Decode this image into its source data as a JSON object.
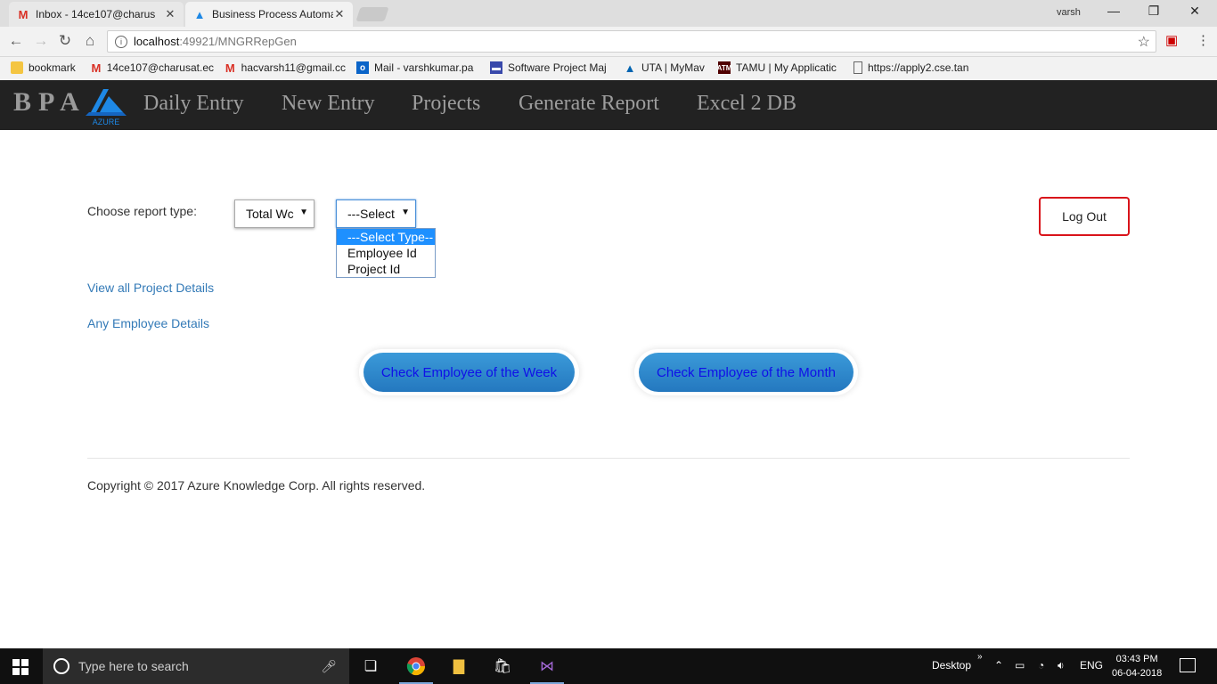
{
  "browser": {
    "tabs": [
      {
        "label": "Inbox - 14ce107@charus",
        "favicon": "gmail-icon",
        "active": false
      },
      {
        "label": "Business Process Automa",
        "favicon": "azure-icon",
        "active": true
      }
    ],
    "window_user": "varsh",
    "url_host": "localhost",
    "url_path": ":49921/MNGRRepGen",
    "bookmarks": [
      {
        "label": "bookmark",
        "icon": "folder-icon"
      },
      {
        "label": "14ce107@charusat.ec",
        "icon": "gmail-icon"
      },
      {
        "label": "hacvarsh11@gmail.cc",
        "icon": "gmail-icon"
      },
      {
        "label": "Mail - varshkumar.pa",
        "icon": "outlook-icon"
      },
      {
        "label": "Software Project Maj",
        "icon": "project-icon"
      },
      {
        "label": "UTA | MyMav",
        "icon": "uta-icon"
      },
      {
        "label": "TAMU | My Applicatic",
        "icon": "tamu-icon"
      },
      {
        "label": "https://apply2.cse.tan",
        "icon": "page-icon"
      }
    ]
  },
  "navbar": {
    "brand": "BPA",
    "logo_text": "AZURE",
    "links": [
      "Daily Entry",
      "New Entry",
      "Projects",
      "Generate Report",
      "Excel 2 DB"
    ]
  },
  "report": {
    "choose_label": "Choose report type:",
    "report_type_value": "Total Wc",
    "filter_value": "---Select",
    "dropdown_options": [
      "---Select Type---",
      "Employee Id",
      "Project Id"
    ],
    "selected_option_index": 0
  },
  "logout_label": "Log Out",
  "links": {
    "view_projects": "View all Project Details",
    "employee_details": "Any Employee Details"
  },
  "buttons": {
    "week": "Check Employee of the Week",
    "month": "Check Employee of the Month"
  },
  "footer": "Copyright © 2017 Azure Knowledge Corp. All rights reserved.",
  "taskbar": {
    "search_placeholder": "Type here to search",
    "desktop_label": "Desktop",
    "language": "ENG",
    "time": "03:43 PM",
    "date": "06-04-2018"
  },
  "colors": {
    "navbar_bg": "#222222",
    "link": "#337ab7",
    "logout_border": "#d9141b",
    "button_gradient_top": "#3b9ad9",
    "button_text": "#1010e8"
  }
}
